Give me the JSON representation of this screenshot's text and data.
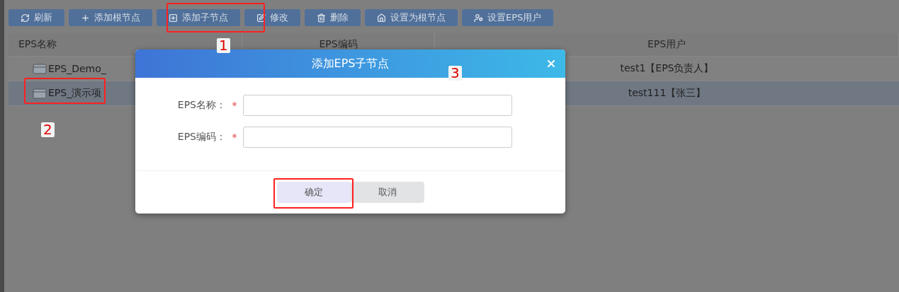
{
  "toolbar": [
    {
      "label": "刷新"
    },
    {
      "label": "添加根节点"
    },
    {
      "label": "添加子节点"
    },
    {
      "label": "修改"
    },
    {
      "label": "删除"
    },
    {
      "label": "设置为根节点"
    },
    {
      "label": "设置EPS用户"
    }
  ],
  "table": {
    "columns": [
      "EPS名称",
      "EPS编码",
      "EPS用户"
    ],
    "rows": [
      {
        "name": "EPS_Demo_",
        "user": "test1【EPS负责人】",
        "selected": false
      },
      {
        "name": "EPS_演示项",
        "user": "test111【张三】",
        "selected": true
      }
    ]
  },
  "dialog": {
    "title": "添加EPS子节点",
    "fields": [
      {
        "label": "EPS名称：",
        "required_mark": "*"
      },
      {
        "label": "EPS编码：",
        "required_mark": "*"
      }
    ],
    "buttons": [
      {
        "label": "确定",
        "kind": "primary"
      },
      {
        "label": "取消",
        "kind": "secondary"
      }
    ]
  },
  "annotations": [
    {
      "label": "1"
    },
    {
      "label": "2"
    },
    {
      "label": "3"
    }
  ]
}
